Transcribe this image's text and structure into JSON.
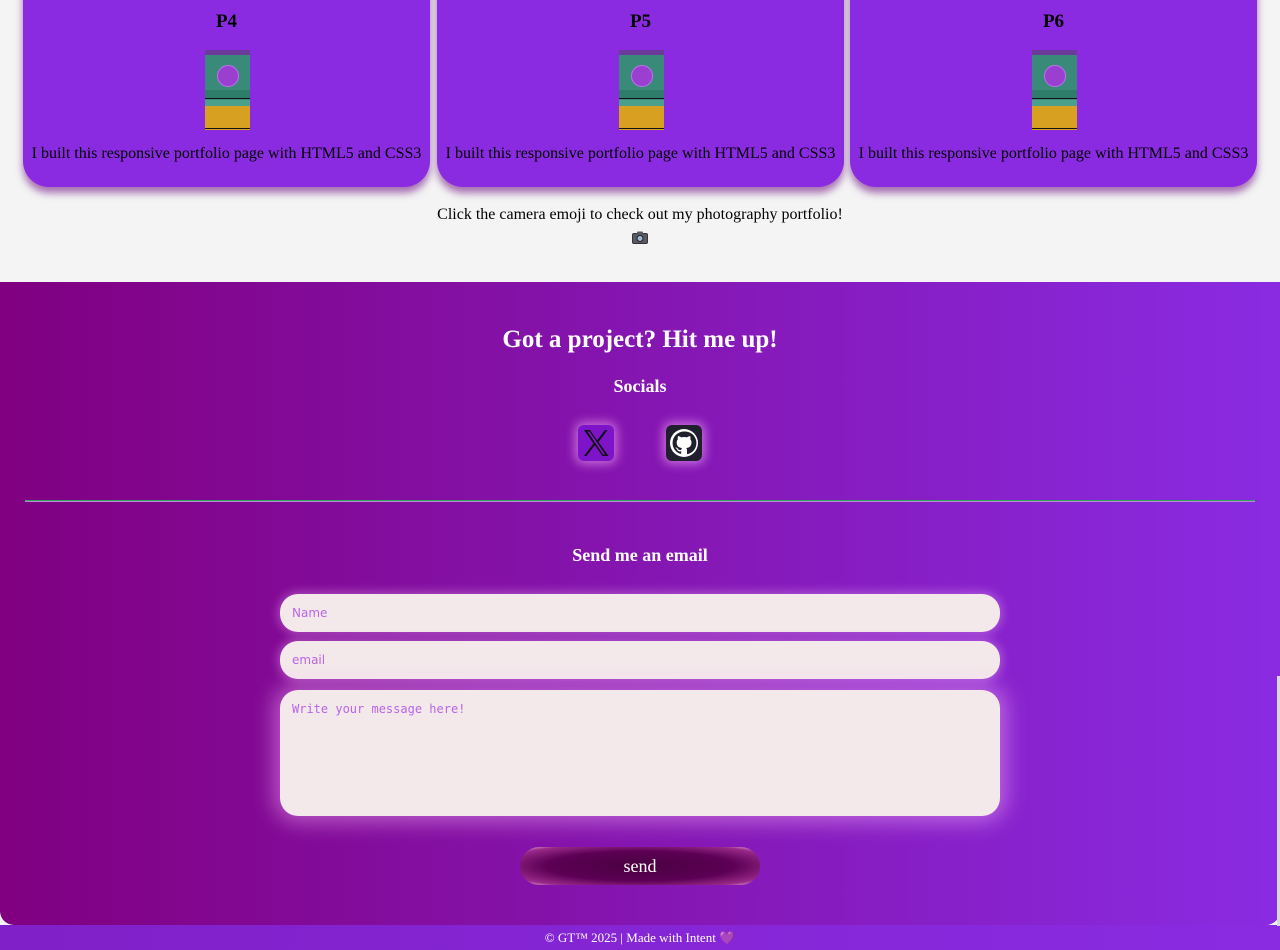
{
  "projects": [
    {
      "title": "P4",
      "description": "I built this responsive portfolio page with HTML5 and CSS3"
    },
    {
      "title": "P5",
      "description": "I built this responsive portfolio page with HTML5 and CSS3"
    },
    {
      "title": "P6",
      "description": "I built this responsive portfolio page with HTML5 and CSS3"
    }
  ],
  "photography": {
    "text": "Click the camera emoji to check out my photography portfolio!",
    "icon": "camera-icon"
  },
  "contact": {
    "title": "Got a project? Hit me up!",
    "socials_title": "Socials",
    "socials": [
      {
        "name": "X",
        "icon": "x-icon"
      },
      {
        "name": "GitHub",
        "icon": "github-icon"
      }
    ],
    "email_title": "Send me an email",
    "form": {
      "name_placeholder": "Name",
      "email_placeholder": "email",
      "message_placeholder": "Write your message here!",
      "send_label": "send"
    }
  },
  "footer": {
    "text": "© GT™ 2025 | Made with Intent 💜"
  },
  "colors": {
    "card": "#8a2be2",
    "gradient_start": "#800080",
    "gradient_end": "#8a2be2"
  }
}
